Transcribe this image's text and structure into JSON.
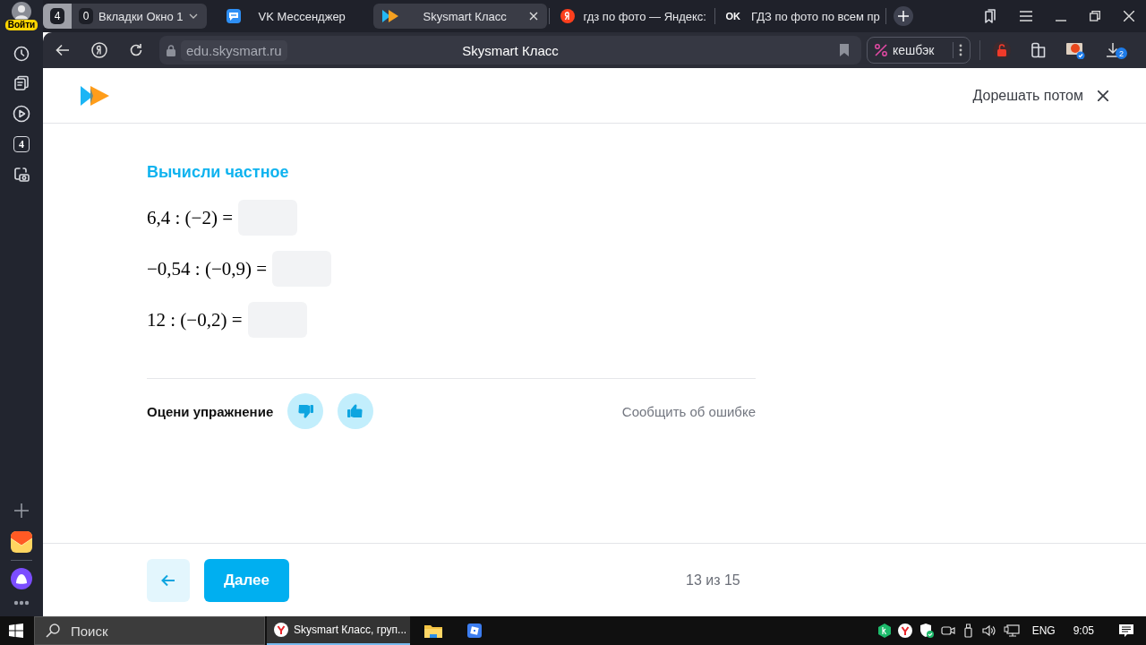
{
  "sidebar": {
    "profile_label": "Войти",
    "tab_count": "4"
  },
  "tab_strip": {
    "group_count": "4",
    "group": {
      "count": "0",
      "label": "Вкладки Окно 1"
    },
    "tabs": [
      {
        "kind": "chat",
        "title": "VK Мессенджер",
        "selected": false
      },
      {
        "kind": "play",
        "title": "Skysmart Класс",
        "selected": true
      },
      {
        "kind": "search",
        "title": "гдз по фото — Яндекс:",
        "selected": false
      },
      {
        "kind": "social",
        "badge": "OK",
        "title": "ГДЗ по фото по всем пр",
        "selected": false
      }
    ]
  },
  "address_bar": {
    "url": "edu.skysmart.ru",
    "page_title": "Skysmart Класс",
    "cashback": "кешбэк",
    "downloads_count": "2"
  },
  "page": {
    "later": "Дорешать потом",
    "task": {
      "title": "Вычисли частное",
      "equations": [
        {
          "expr": "6,4 : (−2) ="
        },
        {
          "expr": "−0,54 : (−0,9) ="
        },
        {
          "expr": "12 : (−0,2) ="
        }
      ]
    },
    "rating_label": "Оцени упражнение",
    "report": "Сообщить об ошибке",
    "next": "Далее",
    "progress": "13 из 15"
  },
  "taskbar": {
    "search_placeholder": "Поиск",
    "apps": [
      {
        "kind": "browser",
        "title": "Skysmart Класс, груп...",
        "selected": true
      },
      {
        "kind": "folder",
        "selected": false
      },
      {
        "kind": "app",
        "selected": false
      }
    ],
    "language": "ENG",
    "time": "9:05"
  }
}
